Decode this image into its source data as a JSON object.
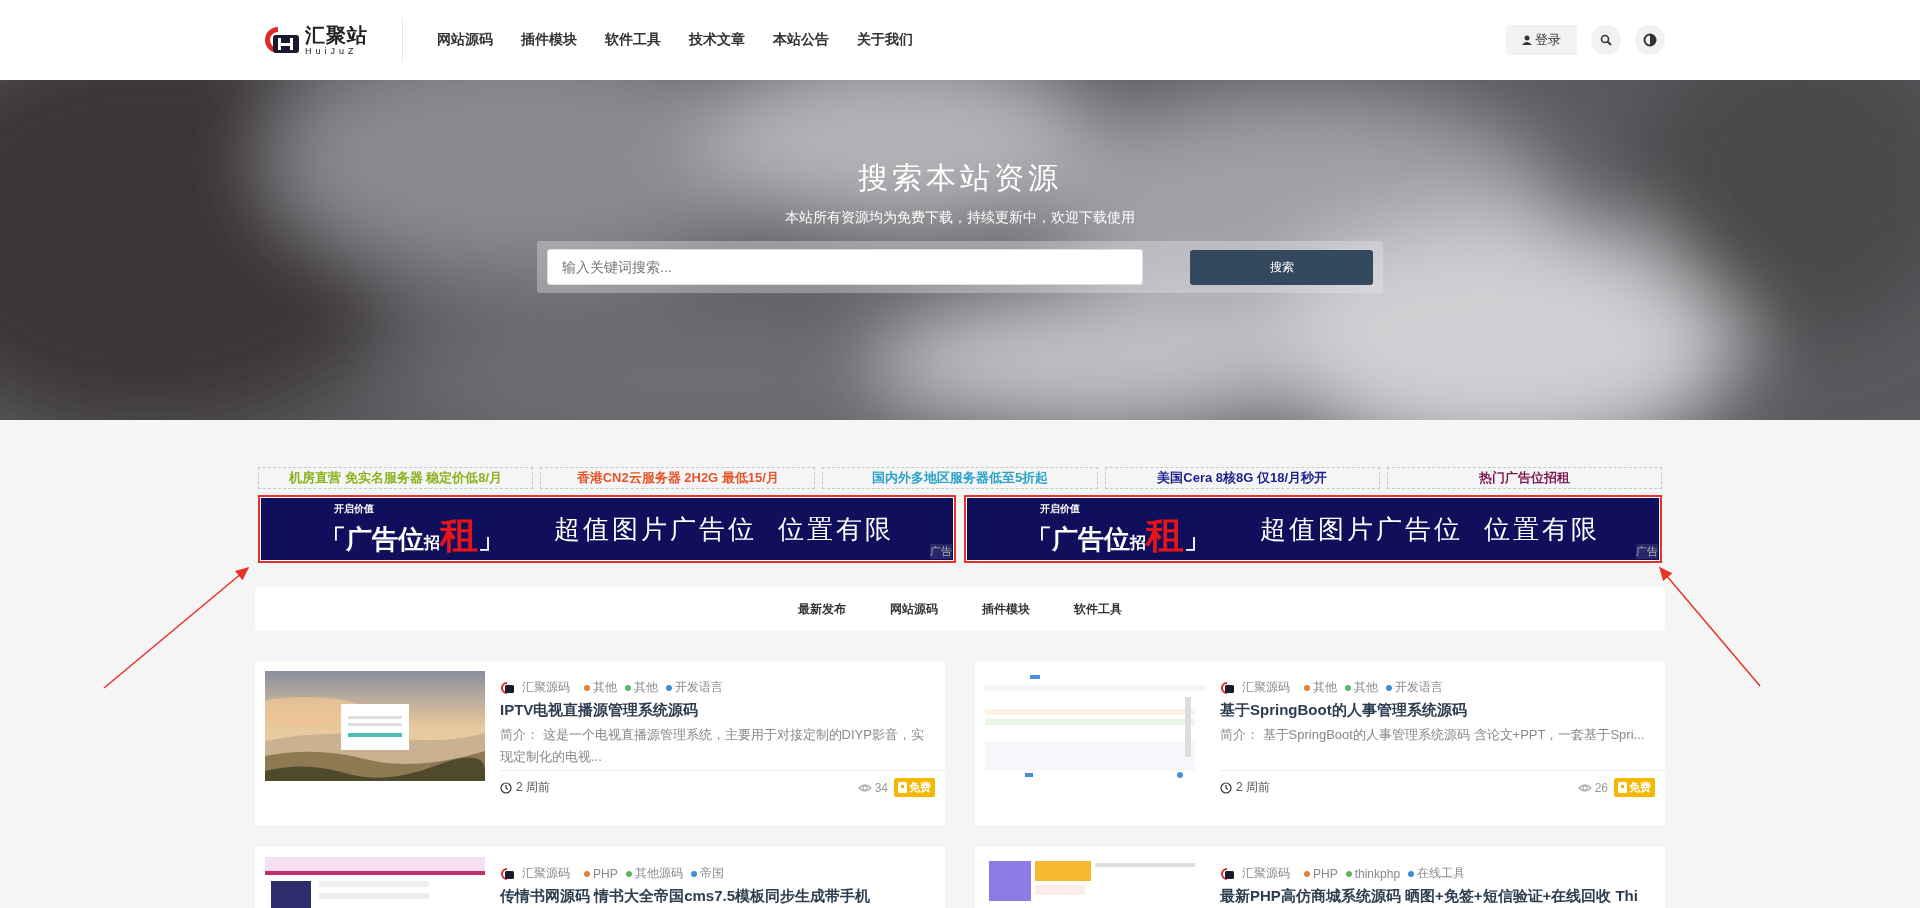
{
  "header": {
    "logo": {
      "name": "汇聚站",
      "sub": "HuiJuZ"
    },
    "nav": [
      {
        "label": "网站源码"
      },
      {
        "label": "插件模块"
      },
      {
        "label": "软件工具"
      },
      {
        "label": "技术文章"
      },
      {
        "label": "本站公告"
      },
      {
        "label": "关于我们"
      }
    ],
    "login": "登录"
  },
  "hero": {
    "title": "搜索本站资源",
    "subtitle": "本站所有资源均为免费下载，持续更新中，欢迎下载使用",
    "search": {
      "placeholder": "输入关键词搜索..."
    },
    "button": "搜索"
  },
  "text_ads": [
    {
      "text": "机房直营 免实名服务器 稳定价低8/月",
      "color": "#8bb21c"
    },
    {
      "text": "香港CN2云服务器 2H2G 最低15/月",
      "color": "#e4552a"
    },
    {
      "text": "国内外多地区服务器低至5折起",
      "color": "#2aa2c9"
    },
    {
      "text": "美国Cera 8核8G 仅18/月秒开",
      "color": "#1a1f8c"
    },
    {
      "text": "热门广告位招租",
      "color": "#7d1b55"
    }
  ],
  "banner_ads": [
    {
      "tag": "开启价值",
      "lead": "「广告位",
      "small": "招",
      "big": "租",
      "close": "」",
      "slogan": "超值图片广告位  位置有限",
      "label": "广告"
    },
    {
      "tag": "开启价值",
      "lead": "「广告位",
      "small": "招",
      "big": "租",
      "close": "」",
      "slogan": "超值图片广告位  位置有限",
      "label": "广告"
    }
  ],
  "tabs": [
    {
      "label": "最新发布",
      "selected": false
    },
    {
      "label": "网站源码",
      "selected": false
    },
    {
      "label": "插件模块",
      "selected": false
    },
    {
      "label": "软件工具",
      "selected": false
    }
  ],
  "posts": [
    {
      "source": "汇聚源码",
      "tags": [
        {
          "text": "其他",
          "color": "#e0823d"
        },
        {
          "text": "其他",
          "color": "#5cb85c"
        },
        {
          "text": "开发语言",
          "color": "#3a8fd6"
        }
      ],
      "title": "IPTV电视直播源管理系统源码",
      "excerpt": "简介： 这是一个电视直播源管理系统，主要用于对接定制的DIYP影音，实现定制化的电视...",
      "time": "2 周前",
      "views": "34",
      "badge": "免费",
      "picture": {
        "kind": "picture"
      }
    },
    {
      "source": "汇聚源码",
      "tags": [
        {
          "text": "其他",
          "color": "#e0823d"
        },
        {
          "text": "其他",
          "color": "#5cb85c"
        },
        {
          "text": "开发语言",
          "color": "#3a8fd6"
        }
      ],
      "title": "基于SpringBoot的人事管理系统源码",
      "excerpt": "简介： 基于SpringBoot的人事管理系统源码 含论文+PPT，一套基于Spri...",
      "time": "2 周前",
      "views": "26",
      "badge": "免费",
      "picture": {
        "kind": "picture"
      }
    },
    {
      "source": "汇聚源码",
      "tags": [
        {
          "text": "PHP",
          "color": "#e0823d"
        },
        {
          "text": "其他源码",
          "color": "#5cb85c"
        },
        {
          "text": "帝国",
          "color": "#3a8fd6"
        }
      ],
      "title": "传情书网源码 情书大全帝国cms7.5模板同步生成带手机",
      "picture": {
        "kind": "picture"
      }
    },
    {
      "source": "汇聚源码",
      "tags": [
        {
          "text": "PHP",
          "color": "#e0823d"
        },
        {
          "text": "thinkphp",
          "color": "#5cb85c"
        },
        {
          "text": "在线工具",
          "color": "#3a8fd6"
        }
      ],
      "title": "最新PHP高仿商城系统源码 晒图+免签+短信验证+在线回收 Thi",
      "picture": {
        "kind": "picture"
      }
    }
  ]
}
